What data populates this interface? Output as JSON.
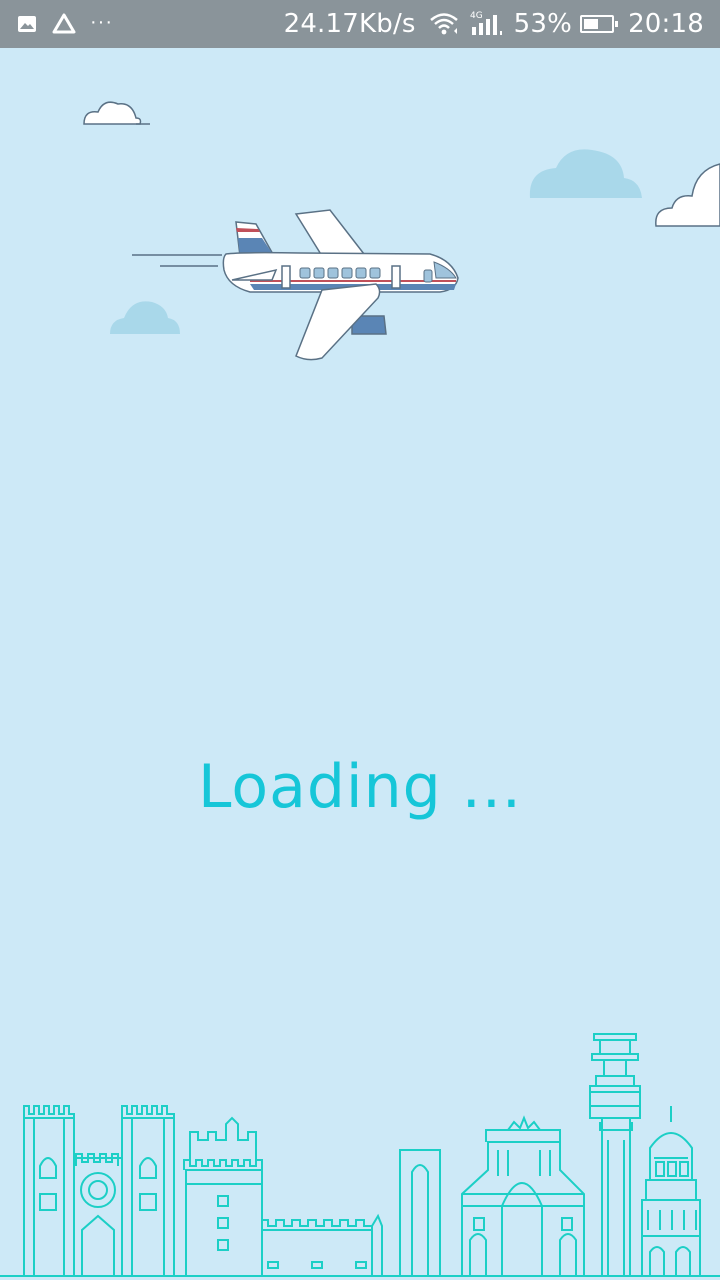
{
  "status_bar": {
    "left_icons": [
      "image-icon",
      "drive-icon",
      "more-dots-icon"
    ],
    "more_dots": "···",
    "network_speed": "24.17Kb/s",
    "network_type": "4G",
    "battery_percent": "53%",
    "battery_level": 0.53,
    "time": "20:18"
  },
  "main": {
    "loading_text": "Loading ..."
  },
  "colors": {
    "background": "#cde9f7",
    "status_bar": "#8a949a",
    "accent_cyan": "#16c6d8",
    "skyline_stroke": "#1ccfc6"
  }
}
